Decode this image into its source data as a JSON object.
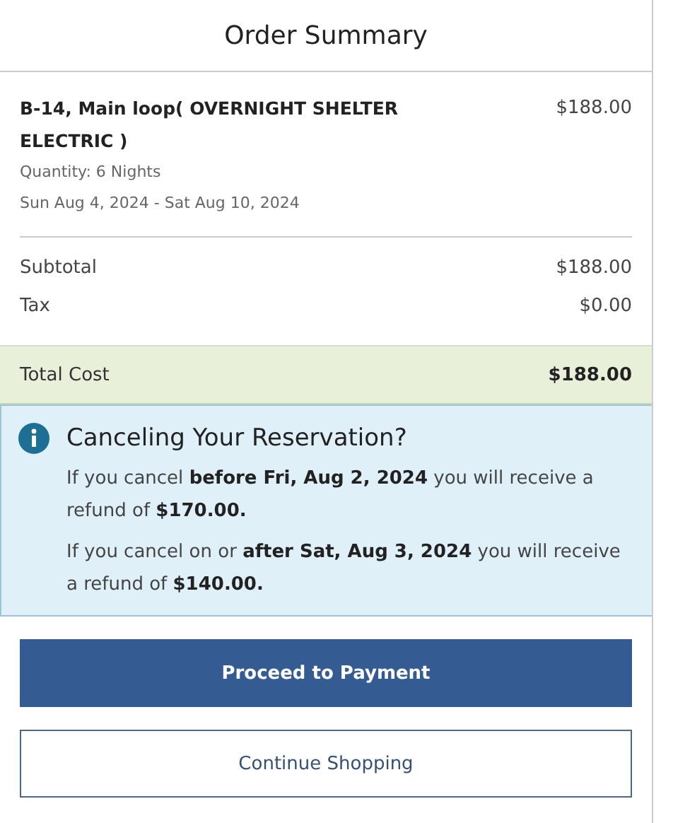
{
  "title": "Order Summary",
  "line_item": {
    "name": "B-14, Main loop( OVERNIGHT SHELTER ELECTRIC )",
    "price": "$188.00",
    "quantity": "Quantity: 6 Nights",
    "dates": "Sun Aug 4, 2024 - Sat Aug 10, 2024"
  },
  "totals": [
    {
      "label": "Subtotal",
      "value": "$188.00",
      "kind": "plain"
    },
    {
      "label": "Tax",
      "value": "$0.00",
      "kind": "plain"
    },
    {
      "label": "Total Cost",
      "value": "$188.00",
      "kind": "total"
    }
  ],
  "notice": {
    "title": "Canceling Your Reservation?",
    "paragraphs": [
      "If you cancel **before Fri, Aug 2, 2024** you will receive a refund of **$170.00.**",
      "If you cancel on or **after Sat, Aug 3, 2024** you will receive a refund of **$140.00.**"
    ]
  },
  "buttons": [
    {
      "label": "Proceed to Payment",
      "kind": "primary"
    },
    {
      "label": "Continue Shopping",
      "kind": "secondary"
    }
  ]
}
